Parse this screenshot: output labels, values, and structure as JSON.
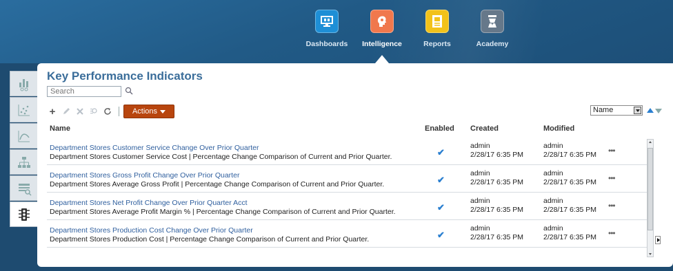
{
  "nav": {
    "items": [
      {
        "label": "Dashboards",
        "icon": "dashboards-monitor-icon",
        "color": "#1e8fd6"
      },
      {
        "label": "Intelligence",
        "icon": "intelligence-head-icon",
        "color": "#f0784d"
      },
      {
        "label": "Reports",
        "icon": "reports-document-icon",
        "color": "#f2c21a"
      },
      {
        "label": "Academy",
        "icon": "academy-graduate-icon",
        "color": "#66788a"
      }
    ],
    "active": "Intelligence"
  },
  "sidebar": {
    "tabs": [
      "bar-chart-glasses-icon",
      "scatter-plot-icon",
      "line-curve-icon",
      "hierarchy-icon",
      "table-search-icon",
      "traffic-light-icon"
    ],
    "active": "traffic-light-icon"
  },
  "page": {
    "title": "Key Performance Indicators",
    "search_placeholder": "Search",
    "actions_label": "Actions",
    "sort_field": "Name"
  },
  "table": {
    "headers": {
      "name": "Name",
      "enabled": "Enabled",
      "created": "Created",
      "modified": "Modified"
    },
    "rows": [
      {
        "name": "Department Stores Customer Service Change Over Prior Quarter",
        "desc": "Department Stores Customer Service Cost | Percentage Change Comparison of Current and Prior Quarter.",
        "created_user": "admin",
        "created_date": "2/28/17 6:35 PM",
        "modified_user": "admin",
        "modified_date": "2/28/17 6:35 PM",
        "more": "•••"
      },
      {
        "name": "Department Stores Gross Profit Change Over Prior Quarter",
        "desc": "Department Stores Average Gross Profit | Percentage Change Comparison of Current and Prior Quarter.",
        "created_user": "admin",
        "created_date": "2/28/17 6:35 PM",
        "modified_user": "admin",
        "modified_date": "2/28/17 6:35 PM",
        "more": "•••"
      },
      {
        "name": "Department Stores Net Profit Change Over Prior Quarter Acct",
        "desc": "Department Stores Average Profit Margin % | Percentage Change Comparison of Current and Prior Quarter.",
        "created_user": "admin",
        "created_date": "2/28/17 6:35 PM",
        "modified_user": "admin",
        "modified_date": "2/28/17 6:35 PM",
        "more": "•••"
      },
      {
        "name": "Department Stores Production Cost Change Over Prior Quarter",
        "desc": "Department Stores Production Cost | Percentage Change Comparison of Current and Prior Quarter.",
        "created_user": "admin",
        "created_date": "2/28/17 6:35 PM",
        "modified_user": "admin",
        "modified_date": "2/28/17 6:35 PM",
        "more": "•••"
      }
    ]
  },
  "colors": {
    "accent": "#b8450e",
    "link": "#2f5f9e",
    "title": "#3a6d9a",
    "check": "#2a7fd0"
  }
}
